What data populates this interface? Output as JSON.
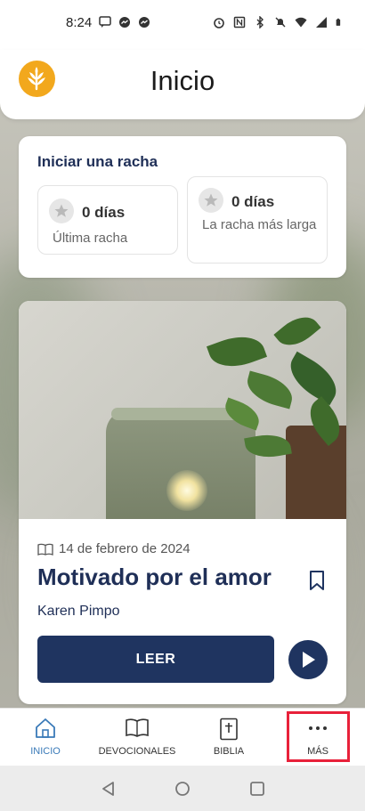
{
  "status_bar": {
    "time": "8:24",
    "left_icons": [
      "chat-icon",
      "messenger-icon",
      "messenger-icon"
    ],
    "right_icons": [
      "alarm-icon",
      "nfc-icon",
      "bluetooth-icon",
      "mute-icon",
      "wifi-icon",
      "signal-icon",
      "battery-icon"
    ]
  },
  "header": {
    "title": "Inicio",
    "logo_color": "#f2a81d"
  },
  "streak": {
    "title": "Iniciar una racha",
    "items": [
      {
        "days": "0 días",
        "label": "Última racha"
      },
      {
        "days": "0 días",
        "label": "La racha más larga"
      }
    ]
  },
  "devotional": {
    "date": "14 de febrero de 2024",
    "title": "Motivado por el amor",
    "author": "Karen Pimpo",
    "read_label": "LEER"
  },
  "nav": {
    "items": [
      {
        "label": "INICIO",
        "icon": "home-icon",
        "active": true
      },
      {
        "label": "DEVOCIONALES",
        "icon": "book-open-icon",
        "active": false
      },
      {
        "label": "BIBLIA",
        "icon": "bible-icon",
        "active": false
      },
      {
        "label": "MÁS",
        "icon": "more-icon",
        "active": false
      }
    ]
  },
  "colors": {
    "primary_navy": "#1f3460",
    "active_blue": "#3a7ab8",
    "highlight_red": "#e8213a"
  }
}
